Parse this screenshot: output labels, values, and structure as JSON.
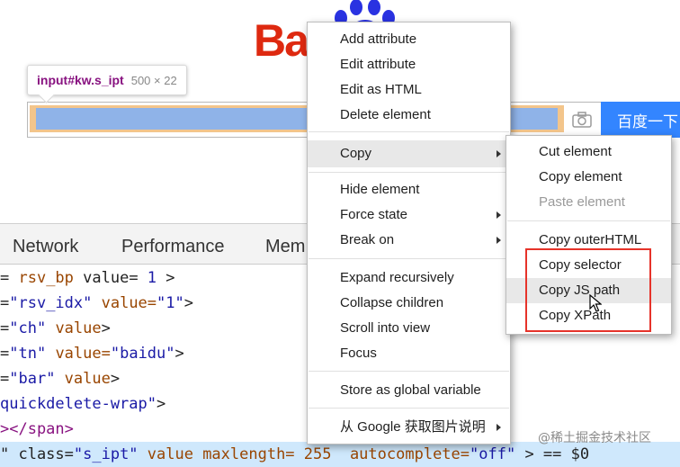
{
  "page": {
    "logo_text": "Ba",
    "logo_paw_name": "baidu-paw-logo",
    "search_button_label": "百度一下",
    "camera_icon": "camera-icon"
  },
  "tooltip": {
    "selector": "input#kw.s_ipt",
    "dimensions": "500 × 22"
  },
  "devtools": {
    "tabs": [
      "Network",
      "Performance",
      "Mem"
    ],
    "code_lines": [
      {
        "pre": "= ",
        "attr": "rsv_bp",
        "mid": " value= ",
        "val": "1",
        "post": " >"
      },
      {
        "pre": "=",
        "attr": "\"rsv_idx\"",
        "mid": " value=",
        "val": "\"1\"",
        "post": ">"
      },
      {
        "pre": "=",
        "attr": "\"ch\"",
        "mid": " value",
        "val": "",
        "post": ">"
      },
      {
        "pre": "=",
        "attr": "\"tn\"",
        "mid": " value=",
        "val": "\"baidu\"",
        "post": ">"
      },
      {
        "pre": "=",
        "attr": "\"bar\"",
        "mid": " value",
        "val": "",
        "post": ">"
      },
      {
        "pre": "",
        "attr": "quickdelete-wrap\"",
        "mid": "",
        "val": "",
        "post": ">"
      },
      {
        "pre": "></span>",
        "attr": "",
        "mid": "",
        "val": "",
        "post": ""
      },
      {
        "pre": "\" class=",
        "attr": "\"s_ipt\"",
        "mid": " value maxlength= 255  autocomplete=",
        "val": "\"off\"",
        "post": " > == $0"
      }
    ]
  },
  "context_menu": {
    "items": [
      {
        "label": "Add attribute"
      },
      {
        "label": "Edit attribute"
      },
      {
        "label": "Edit as HTML"
      },
      {
        "label": "Delete element"
      },
      {
        "label": "Copy"
      },
      {
        "label": "Hide element"
      },
      {
        "label": "Force state"
      },
      {
        "label": "Break on"
      },
      {
        "label": "Expand recursively"
      },
      {
        "label": "Collapse children"
      },
      {
        "label": "Scroll into view"
      },
      {
        "label": "Focus"
      },
      {
        "label": "Store as global variable"
      },
      {
        "label": "从 Google 获取图片说明"
      }
    ]
  },
  "copy_submenu": {
    "items": [
      {
        "label": "Cut element"
      },
      {
        "label": "Copy element"
      },
      {
        "label": "Paste element"
      },
      {
        "label": "Copy outerHTML"
      },
      {
        "label": "Copy selector"
      },
      {
        "label": "Copy JS path"
      },
      {
        "label": "Copy XPath"
      }
    ]
  },
  "watermark": "@稀土掘金技术社区",
  "colors": {
    "baidu_red": "#de2910",
    "baidu_blue": "#3385ff",
    "highlight_box": "#e6332a"
  }
}
